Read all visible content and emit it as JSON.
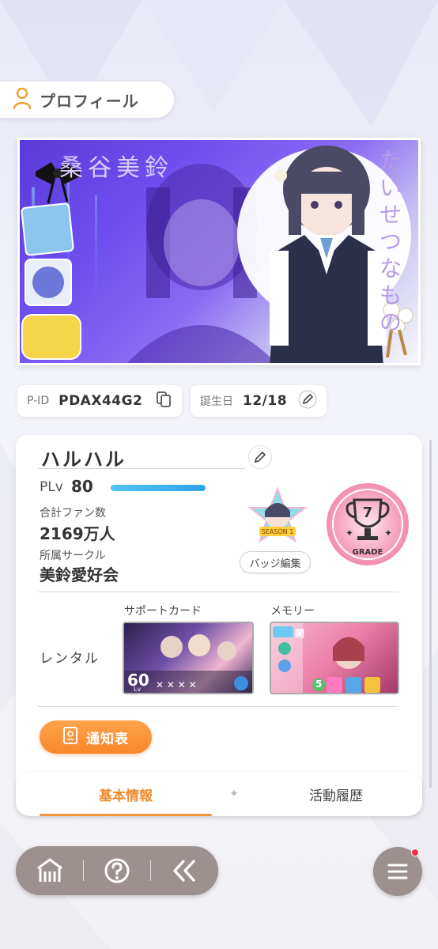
{
  "header": {
    "title": "プロフィール",
    "icon": "user-icon"
  },
  "banner": {
    "character_name": "桑谷美鈴",
    "vertical_text": "たいせつなもの"
  },
  "info": {
    "pid_label": "P-ID",
    "pid_value": "PDAX44G2",
    "birthday_label": "誕生日",
    "birthday_value": "12/18"
  },
  "profile": {
    "user_name": "ハルハル",
    "plv_label": "PLv",
    "plv_value": "80",
    "plv_progress": 1.0,
    "fans_label": "合計ファン数",
    "fans_value": "2169万人",
    "circle_label": "所属サークル",
    "circle_value": "美鈴愛好会",
    "badge_edit_label": "バッジ編集",
    "badge_season_text": "SEASON 1",
    "grade_number": "7",
    "grade_label": "GRADE"
  },
  "rental": {
    "label": "レンタル",
    "support_card_title": "サポートカード",
    "support_card_level": "60",
    "memory_title": "メモリー",
    "memory_tag": "開",
    "memory_number": "5"
  },
  "notice_button": {
    "label": "通知表"
  },
  "tabs": [
    {
      "label": "基本情報",
      "active": true
    },
    {
      "label": "活動履歴",
      "active": false
    }
  ],
  "colors": {
    "accent_orange": "#f5953a",
    "nav_bg": "#9d918f",
    "plv_bar": "#2ea4ea",
    "grade_pink": "#f7a4c0"
  }
}
